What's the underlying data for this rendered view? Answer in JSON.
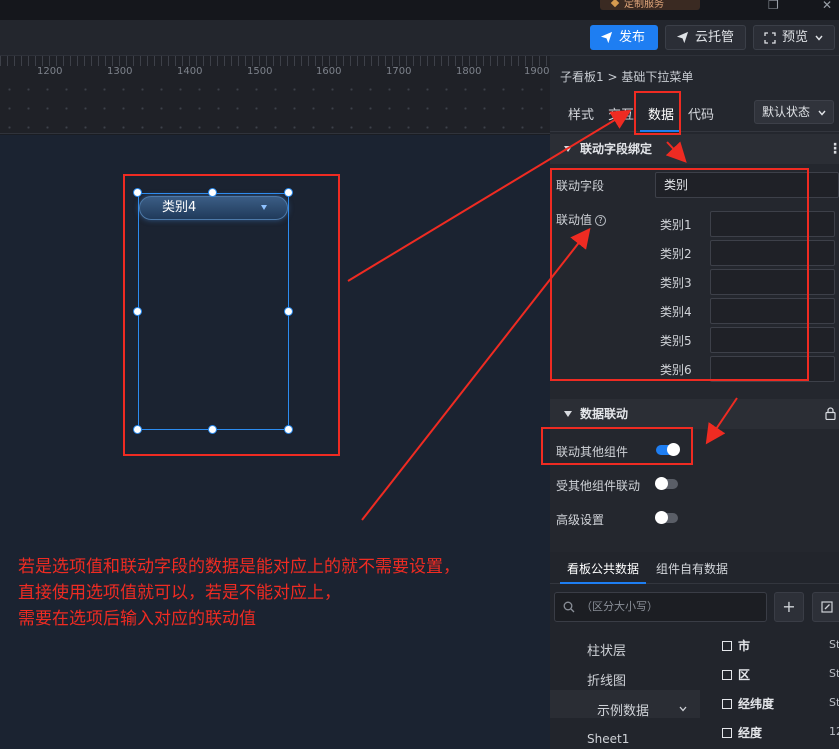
{
  "top": {
    "service_label": "定制服务"
  },
  "toolbar": {
    "publish": "发布",
    "cloud_host": "云托管",
    "preview": "预览"
  },
  "ruler": {
    "ticks": [
      "1200",
      "1300",
      "1400",
      "1500",
      "1600",
      "1700",
      "1800",
      "1900"
    ]
  },
  "widget": {
    "dropdown_value": "类别4"
  },
  "note": {
    "line1": "若是选项值和联动字段的数据是能对应上的就不需要设置，",
    "line2": "直接使用选项值就可以，若是不能对应上，",
    "line3": "需要在选项后输入对应的联动值"
  },
  "panel": {
    "breadcrumb": "子看板1 > 基础下拉菜单",
    "tabs": [
      "样式",
      "交互",
      "数据",
      "代码"
    ],
    "state_select": "默认状态",
    "section_binding": "联动字段绑定",
    "link_field_label": "联动字段",
    "link_field_value": "类别",
    "link_value_label": "联动值",
    "link_values": [
      {
        "label": "类别1",
        "value": ""
      },
      {
        "label": "类别2",
        "value": ""
      },
      {
        "label": "类别3",
        "value": ""
      },
      {
        "label": "类别4",
        "value": ""
      },
      {
        "label": "类别5",
        "value": ""
      },
      {
        "label": "类别6",
        "value": ""
      }
    ],
    "section_data_link": "数据联动",
    "toggles": [
      {
        "label": "联动其他组件",
        "on": true
      },
      {
        "label": "受其他组件联动",
        "on": false
      },
      {
        "label": "高级设置",
        "on": false
      }
    ],
    "lower_tabs": [
      "看板公共数据",
      "组件自有数据"
    ],
    "search_placeholder": "（区分大小写）",
    "tree": [
      "柱状层",
      "折线图",
      "示例数据",
      "Sheet1"
    ],
    "fields": [
      {
        "name": "市",
        "type": "St"
      },
      {
        "name": "区",
        "type": "St"
      },
      {
        "name": "经纬度",
        "type": "St"
      },
      {
        "name": "经度",
        "type": "12"
      }
    ]
  },
  "colors": {
    "accent": "#1e7ef2",
    "annotation": "#ef2b22",
    "panel_bg": "#24272e",
    "canvas_bg": "#1b2331"
  },
  "icons": [
    "send-icon",
    "cloud-send-icon",
    "fullscreen-icon",
    "chevron-down-icon",
    "more-icon",
    "lock-icon",
    "help-icon",
    "search-icon",
    "plus-icon",
    "edit-icon",
    "checkbox-icon"
  ]
}
